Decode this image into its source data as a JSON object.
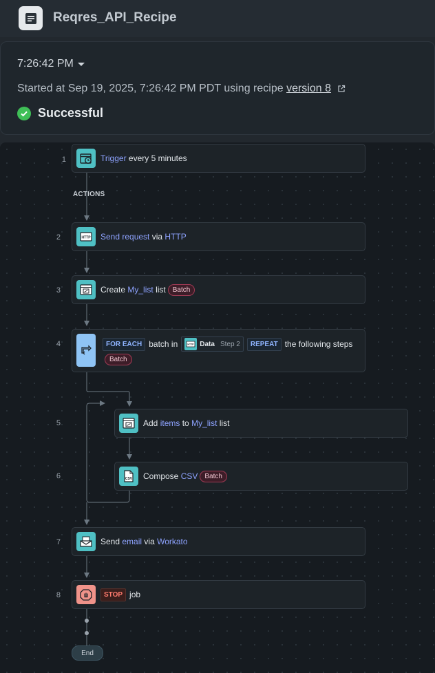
{
  "header": {
    "title": "Reqres_API_Recipe"
  },
  "job": {
    "time": "7:26:42 PM",
    "started_prefix": "Started at Sep 19, 2025, 7:26:42 PM PDT using recipe",
    "version_link": "version 8",
    "status": "Successful"
  },
  "flow": {
    "actions_label": "ACTIONS",
    "end_label": "End",
    "steps": [
      {
        "num": "1",
        "icon": "scheduler-clock-icon",
        "parts": [
          "Trigger",
          "every 5 minutes"
        ]
      },
      {
        "num": "2",
        "icon": "http-icon",
        "parts": [
          "Send request",
          "via",
          "HTTP"
        ]
      },
      {
        "num": "3",
        "icon": "list-icon",
        "parts": [
          "Create",
          "My_list",
          "list",
          "Batch"
        ]
      },
      {
        "num": "4",
        "icon": "loop-icon",
        "parts": [
          "FOR EACH",
          "batch in",
          "Data",
          "Step 2",
          "REPEAT",
          "the following steps",
          "Batch"
        ]
      },
      {
        "num": "5",
        "icon": "list-icon",
        "parts": [
          "Add",
          "items",
          "to",
          "My_list",
          "list"
        ]
      },
      {
        "num": "6",
        "icon": "csv-icon",
        "parts": [
          "Compose",
          "CSV",
          "Batch"
        ]
      },
      {
        "num": "7",
        "icon": "email-icon",
        "parts": [
          "Send",
          "email",
          "via",
          "Workato"
        ]
      },
      {
        "num": "8",
        "icon": "stop-hand-icon",
        "parts": [
          "STOP",
          "job"
        ]
      }
    ]
  },
  "colors": {
    "canvas": "#161b20",
    "step_icon": "#4fc0c4",
    "loop_icon": "#8fc4f5",
    "stop_icon": "#f0938a",
    "link": "#8ea3ff",
    "success": "#3fbf57",
    "pill_border": "#a23b55"
  }
}
